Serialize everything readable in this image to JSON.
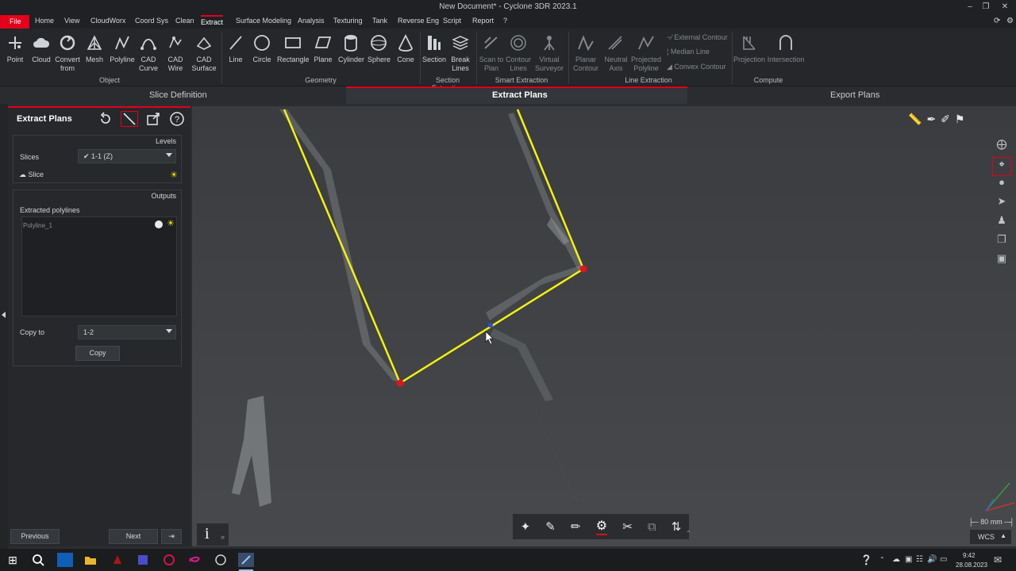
{
  "window": {
    "title": "New Document* - Cyclone 3DR 2023.1"
  },
  "menu": [
    "File",
    "Home",
    "View",
    "CloudWorx",
    "Coord Sys",
    "Clean",
    "Extract",
    "Surface Modeling",
    "Analysis",
    "Texturing",
    "Tank",
    "Reverse Eng",
    "Script",
    "Report",
    "?"
  ],
  "ribbon": {
    "object": [
      {
        "l1": "Point",
        "l2": ""
      },
      {
        "l1": "Cloud",
        "l2": ""
      },
      {
        "l1": "Convert",
        "l2": "from"
      },
      {
        "l1": "Mesh",
        "l2": ""
      },
      {
        "l1": "Polyline",
        "l2": ""
      },
      {
        "l1": "CAD",
        "l2": "Curve"
      },
      {
        "l1": "CAD",
        "l2": "Wire"
      },
      {
        "l1": "CAD",
        "l2": "Surface"
      }
    ],
    "geometry": [
      "Line",
      "Circle",
      "Rectangle",
      "Plane",
      "Cylinder",
      "Sphere",
      "Cone"
    ],
    "section": [
      {
        "l1": "Section",
        "l2": ""
      },
      {
        "l1": "Break",
        "l2": "Lines"
      }
    ],
    "smart": [
      {
        "l1": "Scan to",
        "l2": "Plan"
      },
      {
        "l1": "Contour",
        "l2": "Lines"
      },
      {
        "l1": "Virtual",
        "l2": "Surveyor"
      }
    ],
    "line_extraction": [
      {
        "l1": "Planar",
        "l2": "Contour"
      },
      {
        "l1": "Neutral",
        "l2": "Axis"
      },
      {
        "l1": "Projected",
        "l2": "Polyline"
      }
    ],
    "line_extraction_small": [
      "External Contour",
      "Median Line",
      "Convex Contour"
    ],
    "compute": [
      "Projection",
      "Intersection"
    ],
    "groups": {
      "object": "Object",
      "geometry": "Geometry",
      "section": "Section Extraction",
      "smart": "Smart Extraction",
      "line": "Line Extraction",
      "compute": "Compute"
    }
  },
  "wizard": {
    "step1": "Slice Definition",
    "step2": "Extract Plans",
    "step3": "Export Plans"
  },
  "panel": {
    "title": "Extract Plans",
    "levels_header": "Levels",
    "slices_label": "Slices",
    "slices_value": "1-1 (Z)",
    "slice_item": "Slice",
    "outputs_header": "Outputs",
    "extracted_label": "Extracted polylines",
    "polyline_item": "Polyline_1",
    "copy_to_label": "Copy to",
    "copy_to_value": "1-2",
    "copy_button": "Copy",
    "previous_button": "Previous",
    "next_button": "Next"
  },
  "viewport": {
    "scale_label": "80 mm",
    "coord_system": "WCS",
    "info_glyph": "i"
  },
  "taskbar": {
    "time": "9:42",
    "date": "28.08.2023"
  },
  "colors": {
    "accent": "#e3001b",
    "polyline": "#f2f20f",
    "vertex": "#e0141e"
  }
}
